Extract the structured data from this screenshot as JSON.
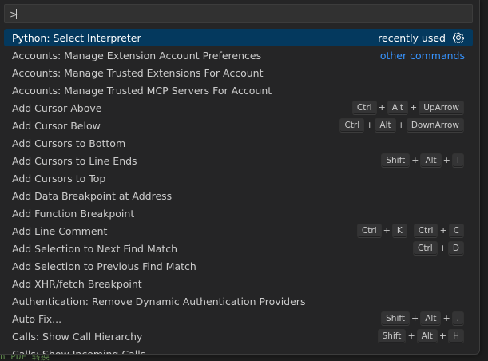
{
  "palette": {
    "input_value": ">",
    "items": [
      {
        "label": "Python: Select Interpreter",
        "meta": "recently used",
        "has_gear": true,
        "selected": true
      },
      {
        "label": "Accounts: Manage Extension Account Preferences",
        "link": "other commands"
      },
      {
        "label": "Accounts: Manage Trusted Extensions For Account"
      },
      {
        "label": "Accounts: Manage Trusted MCP Servers For Account"
      },
      {
        "label": "Add Cursor Above",
        "keys": [
          [
            "Ctrl",
            "Alt",
            "UpArrow"
          ]
        ]
      },
      {
        "label": "Add Cursor Below",
        "keys": [
          [
            "Ctrl",
            "Alt",
            "DownArrow"
          ]
        ]
      },
      {
        "label": "Add Cursors to Bottom"
      },
      {
        "label": "Add Cursors to Line Ends",
        "keys": [
          [
            "Shift",
            "Alt",
            "I"
          ]
        ]
      },
      {
        "label": "Add Cursors to Top"
      },
      {
        "label": "Add Data Breakpoint at Address"
      },
      {
        "label": "Add Function Breakpoint"
      },
      {
        "label": "Add Line Comment",
        "keys": [
          [
            "Ctrl",
            "K"
          ],
          [
            "Ctrl",
            "C"
          ]
        ]
      },
      {
        "label": "Add Selection to Next Find Match",
        "keys": [
          [
            "Ctrl",
            "D"
          ]
        ]
      },
      {
        "label": "Add Selection to Previous Find Match"
      },
      {
        "label": "Add XHR/fetch Breakpoint"
      },
      {
        "label": "Authentication: Remove Dynamic Authentication Providers"
      },
      {
        "label": "Auto Fix...",
        "keys": [
          [
            "Shift",
            "Alt",
            "."
          ]
        ]
      },
      {
        "label": "Calls: Show Call Hierarchy",
        "keys": [
          [
            "Shift",
            "Alt",
            "H"
          ]
        ]
      },
      {
        "label": "Calls: Show Incoming Calls"
      }
    ]
  },
  "editor_peek": "n PDF 转换",
  "icons": {
    "gear": "gear-icon"
  },
  "colors": {
    "selection_bg": "#04395e",
    "link": "#3794ff",
    "background": "#252526",
    "text": "#cccccc"
  }
}
